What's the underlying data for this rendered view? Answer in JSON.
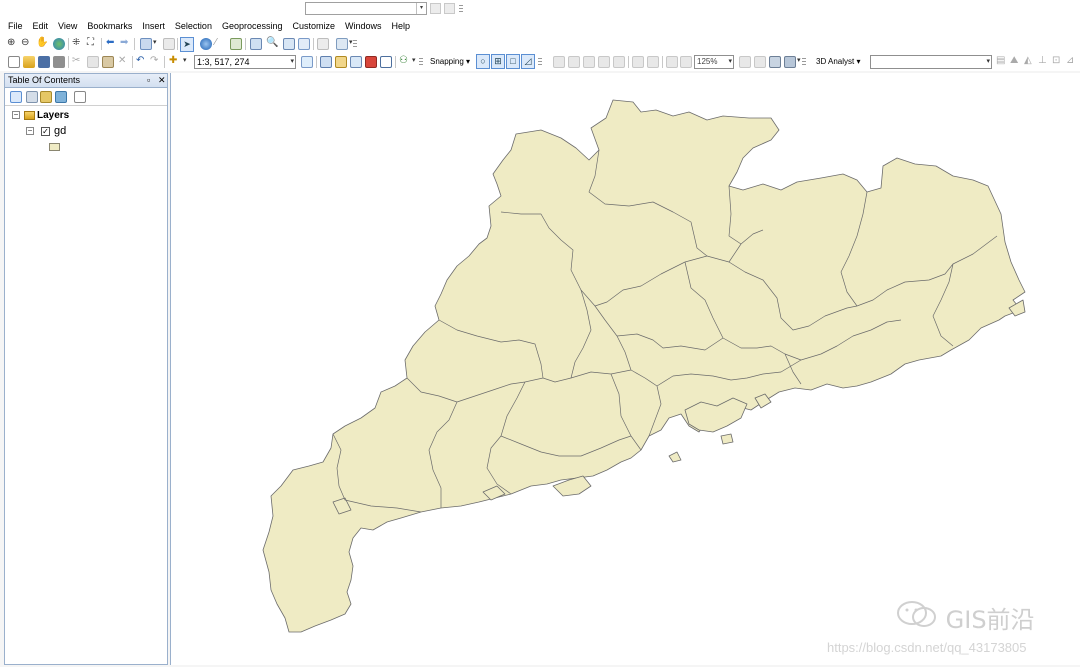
{
  "menubar": {
    "items": [
      "File",
      "Edit",
      "View",
      "Bookmarks",
      "Insert",
      "Selection",
      "Geoprocessing",
      "Customize",
      "Windows",
      "Help"
    ]
  },
  "toolbar": {
    "scale_value": "1:3, 517, 274",
    "snapping_label": "Snapping",
    "zoom_value": "125%",
    "analyst_label": "3D Analyst"
  },
  "toc": {
    "title": "Table Of Contents",
    "root_label": "Layers",
    "layer_name": "gd",
    "layer_visible": true,
    "symbol_color": "#efebc4"
  },
  "map": {
    "fill_color": "#efebc4",
    "stroke_color": "#6b6b6b"
  },
  "watermark": {
    "brand": "GIS前沿",
    "url": "https://blog.csdn.net/qq_43173805"
  }
}
